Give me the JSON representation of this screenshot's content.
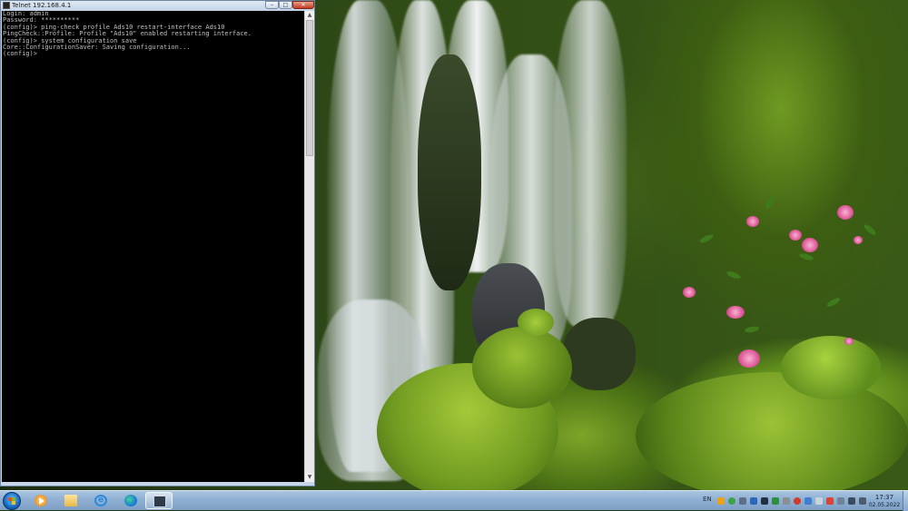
{
  "window": {
    "title": "Telnet 192.168.4.1",
    "minimize_label": "–",
    "maximize_label": "□",
    "close_label": "✕"
  },
  "console": {
    "lines": [
      "Login: admin",
      "Password: **********",
      "(config)> ping-check profile Ads10 restart-interface Ads10",
      "PingCheck::Profile: Profile \"Ads10\" enabled restarting interface.",
      "(config)> system configuration save",
      "Core::ConfigurationSaver: Saving configuration...",
      "(config)>"
    ]
  },
  "taskbar": {
    "items": [
      {
        "name": "media-player-icon",
        "active": false
      },
      {
        "name": "folder-icon",
        "active": false
      },
      {
        "name": "internet-explorer-icon",
        "active": false
      },
      {
        "name": "edge-icon",
        "active": false
      },
      {
        "name": "telnet-icon",
        "active": true
      }
    ],
    "language": "EN",
    "time": "17:37",
    "date": "02.05.2022"
  },
  "colors": {
    "console_bg": "#000000",
    "console_text": "#c0c0c0",
    "taskbar": "#8fb0d3",
    "flower": "#e05a9a"
  }
}
